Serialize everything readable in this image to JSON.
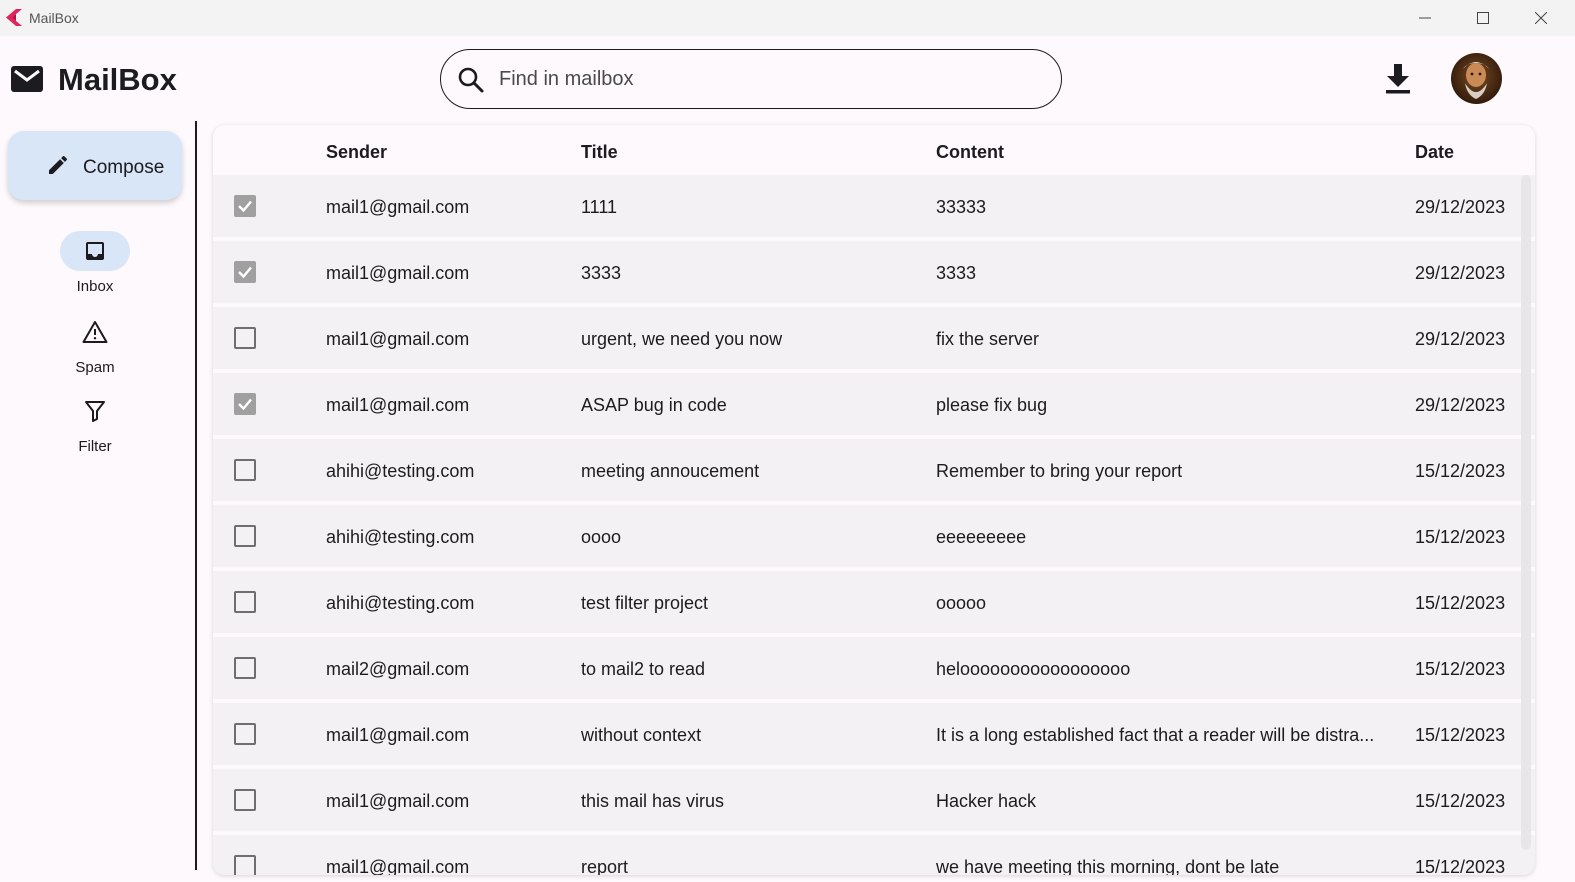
{
  "window": {
    "title": "MailBox",
    "icons": [
      "app-logo-icon",
      "minimize-icon",
      "maximize-icon",
      "close-icon"
    ]
  },
  "header": {
    "brand": "MailBox",
    "search_placeholder": "Find in mailbox",
    "icons": [
      "mail-icon",
      "search-icon",
      "download-icon",
      "avatar"
    ]
  },
  "sidebar": {
    "compose_label": "Compose",
    "items": [
      {
        "label": "Inbox",
        "icon": "inbox-icon",
        "active": true
      },
      {
        "label": "Spam",
        "icon": "warning-icon",
        "active": false
      },
      {
        "label": "Filter",
        "icon": "filter-icon",
        "active": false
      }
    ]
  },
  "table": {
    "columns": [
      "Sender",
      "Title",
      "Content",
      "Date"
    ],
    "rows": [
      {
        "checked": true,
        "sender": "mail1@gmail.com",
        "title": "1111",
        "content": "33333",
        "date": "29/12/2023"
      },
      {
        "checked": true,
        "sender": "mail1@gmail.com",
        "title": "3333",
        "content": "3333",
        "date": "29/12/2023"
      },
      {
        "checked": false,
        "sender": "mail1@gmail.com",
        "title": "urgent, we need you now",
        "content": "fix the server",
        "date": "29/12/2023"
      },
      {
        "checked": true,
        "sender": "mail1@gmail.com",
        "title": "ASAP bug in code",
        "content": "please fix bug",
        "date": "29/12/2023"
      },
      {
        "checked": false,
        "sender": "ahihi@testing.com",
        "title": "meeting annoucement",
        "content": "Remember to bring your report",
        "date": "15/12/2023"
      },
      {
        "checked": false,
        "sender": "ahihi@testing.com",
        "title": "oooo",
        "content": "eeeeeeeee",
        "date": "15/12/2023"
      },
      {
        "checked": false,
        "sender": "ahihi@testing.com",
        "title": "test filter project",
        "content": "ooooo",
        "date": "15/12/2023"
      },
      {
        "checked": false,
        "sender": "mail2@gmail.com",
        "title": "to mail2 to read",
        "content": "helooooooooooooooooo",
        "date": "15/12/2023"
      },
      {
        "checked": false,
        "sender": "mail1@gmail.com",
        "title": "without context",
        "content": "It is a long established fact that a reader will be distra...",
        "date": "15/12/2023"
      },
      {
        "checked": false,
        "sender": "mail1@gmail.com",
        "title": "this mail has virus",
        "content": "Hacker hack",
        "date": "15/12/2023"
      },
      {
        "checked": false,
        "sender": "mail1@gmail.com",
        "title": "report",
        "content": "we have meeting this morning, dont be late",
        "date": "15/12/2023"
      }
    ]
  },
  "colors": {
    "background": "#fdf9fc",
    "accent": "#d8e6f8",
    "row": "#f3f1f3",
    "checkbox_checked": "#a0a0a0"
  }
}
